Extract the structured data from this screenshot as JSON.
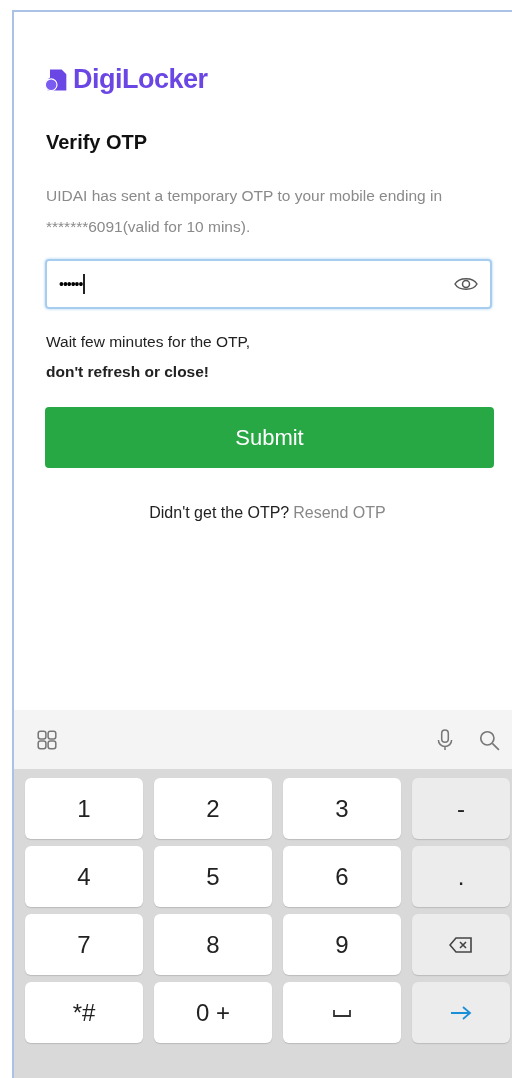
{
  "brand": "DigiLocker",
  "title": "Verify OTP",
  "description": "UIDAI has sent a temporary OTP to your mobile ending in *******6091(valid for 10 mins).",
  "otp_field": {
    "value": "••••••",
    "focused": true
  },
  "notice": [
    "Wait few minutes for the OTP,",
    "don't refresh or close!"
  ],
  "submit": "Submit",
  "resend": {
    "prompt": "Didn't get the OTP?",
    "link": "Resend OTP"
  },
  "keyboard": {
    "keys": [
      {
        "kind": "digit",
        "label": "1"
      },
      {
        "kind": "digit",
        "label": "2"
      },
      {
        "kind": "digit",
        "label": "3"
      },
      {
        "kind": "function",
        "label": "-"
      },
      {
        "kind": "digit",
        "label": "4"
      },
      {
        "kind": "digit",
        "label": "5"
      },
      {
        "kind": "digit",
        "label": "6"
      },
      {
        "kind": "function",
        "label": "."
      },
      {
        "kind": "digit",
        "label": "7"
      },
      {
        "kind": "digit",
        "label": "8"
      },
      {
        "kind": "digit",
        "label": "9"
      },
      {
        "kind": "backspace"
      },
      {
        "kind": "digit",
        "label": "*#"
      },
      {
        "kind": "digit",
        "label": "0 +"
      },
      {
        "kind": "space"
      },
      {
        "kind": "enter"
      }
    ]
  }
}
